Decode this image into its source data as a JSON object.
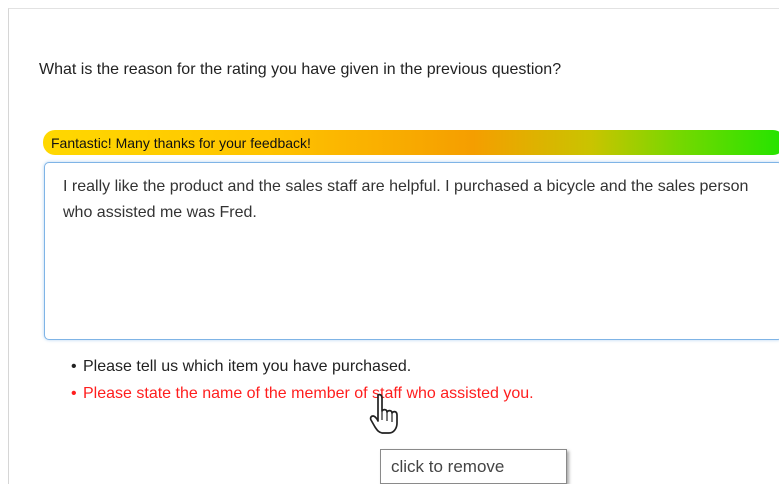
{
  "survey": {
    "question": "What is the reason for the rating you have given in the previous question?",
    "feedback_message": "Fantastic! Many thanks for your feedback!",
    "comment_value": "I really like the product and the sales staff are helpful. I purchased a bicycle and the sales person who assisted me was Fred.",
    "hints": [
      {
        "bullet": "•",
        "text": "Please tell us which item you have purchased.",
        "status": "normal"
      },
      {
        "bullet": "•",
        "text": "Please state the name of the member of staff who assisted you.",
        "status": "highlighted"
      }
    ],
    "tooltip": "click to remove"
  },
  "icons": {
    "cursor": "hand-pointer-icon"
  },
  "colors": {
    "gradient_start": "#ffd800",
    "gradient_middle": "#f59e00",
    "gradient_end": "#22e400",
    "hint_highlight": "#ff1e1e",
    "input_border": "#7fb4e6"
  }
}
